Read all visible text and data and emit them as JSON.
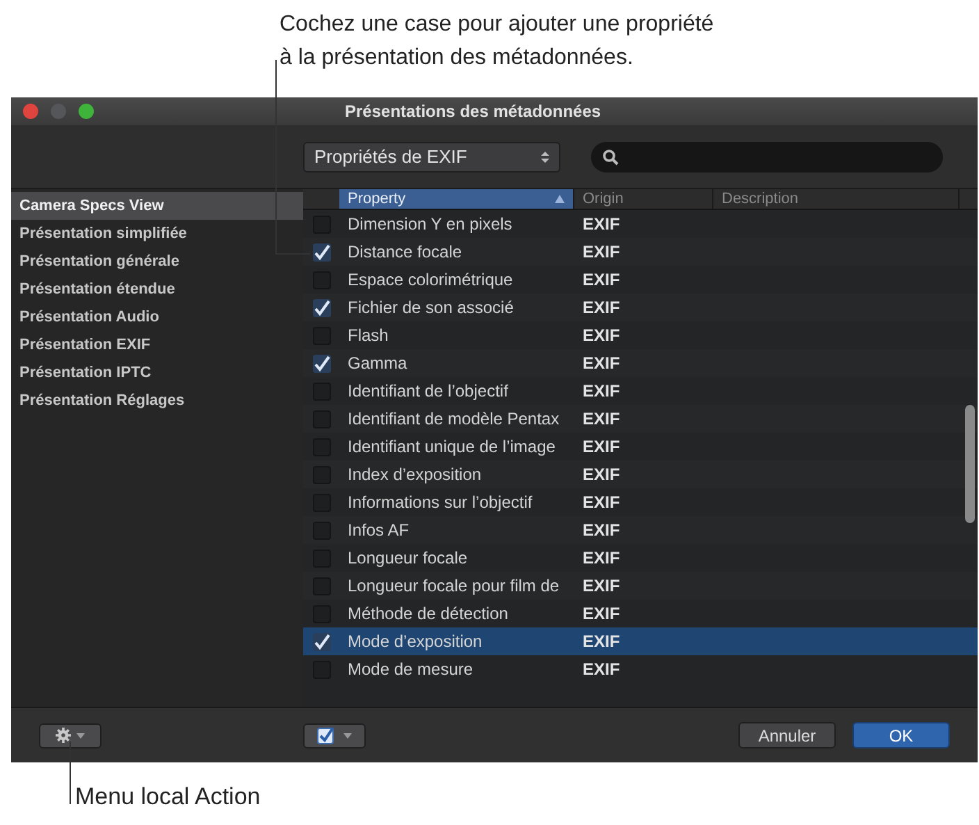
{
  "annotations": {
    "top": "Cochez une case pour ajouter une propriété à la présentation des métadonnées.",
    "bottom": "Menu local Action"
  },
  "window": {
    "title": "Présentations des métadonnées"
  },
  "toolbar": {
    "dropdown": {
      "value": "Propriétés de EXIF"
    }
  },
  "sidebar": {
    "items": [
      {
        "label": "Camera Specs View",
        "selected": true
      },
      {
        "label": "Présentation simplifiée",
        "selected": false
      },
      {
        "label": "Présentation générale",
        "selected": false
      },
      {
        "label": "Présentation étendue",
        "selected": false
      },
      {
        "label": "Présentation Audio",
        "selected": false
      },
      {
        "label": "Présentation EXIF",
        "selected": false
      },
      {
        "label": "Présentation IPTC",
        "selected": false
      },
      {
        "label": "Présentation Réglages",
        "selected": false
      }
    ]
  },
  "table": {
    "columns": [
      {
        "label": "Property",
        "selected": true
      },
      {
        "label": "Origin",
        "selected": false
      },
      {
        "label": "Description",
        "selected": false
      }
    ],
    "rows": [
      {
        "property": "Dimension Y en pixels",
        "origin": "EXIF",
        "checked": false,
        "selected": false
      },
      {
        "property": "Distance focale",
        "origin": "EXIF",
        "checked": true,
        "selected": false
      },
      {
        "property": "Espace colorimétrique",
        "origin": "EXIF",
        "checked": false,
        "selected": false
      },
      {
        "property": "Fichier de son associé",
        "origin": "EXIF",
        "checked": true,
        "selected": false
      },
      {
        "property": "Flash",
        "origin": "EXIF",
        "checked": false,
        "selected": false
      },
      {
        "property": "Gamma",
        "origin": "EXIF",
        "checked": true,
        "selected": false
      },
      {
        "property": "Identifiant de l’objectif",
        "origin": "EXIF",
        "checked": false,
        "selected": false
      },
      {
        "property": "Identifiant de modèle Pentax",
        "origin": "EXIF",
        "checked": false,
        "selected": false
      },
      {
        "property": "Identifiant unique de l’image",
        "origin": "EXIF",
        "checked": false,
        "selected": false
      },
      {
        "property": "Index d’exposition",
        "origin": "EXIF",
        "checked": false,
        "selected": false
      },
      {
        "property": "Informations sur l’objectif",
        "origin": "EXIF",
        "checked": false,
        "selected": false
      },
      {
        "property": "Infos AF",
        "origin": "EXIF",
        "checked": false,
        "selected": false
      },
      {
        "property": "Longueur focale",
        "origin": "EXIF",
        "checked": false,
        "selected": false
      },
      {
        "property": "Longueur focale pour film de",
        "origin": "EXIF",
        "checked": false,
        "selected": false
      },
      {
        "property": "Méthode de détection",
        "origin": "EXIF",
        "checked": false,
        "selected": false
      },
      {
        "property": "Mode d’exposition",
        "origin": "EXIF",
        "checked": true,
        "selected": true
      },
      {
        "property": "Mode de mesure",
        "origin": "EXIF",
        "checked": false,
        "selected": false
      }
    ]
  },
  "buttons": [
    {
      "label": "Annuler",
      "kind": "cancel"
    },
    {
      "label": "OK",
      "kind": "default"
    }
  ]
}
